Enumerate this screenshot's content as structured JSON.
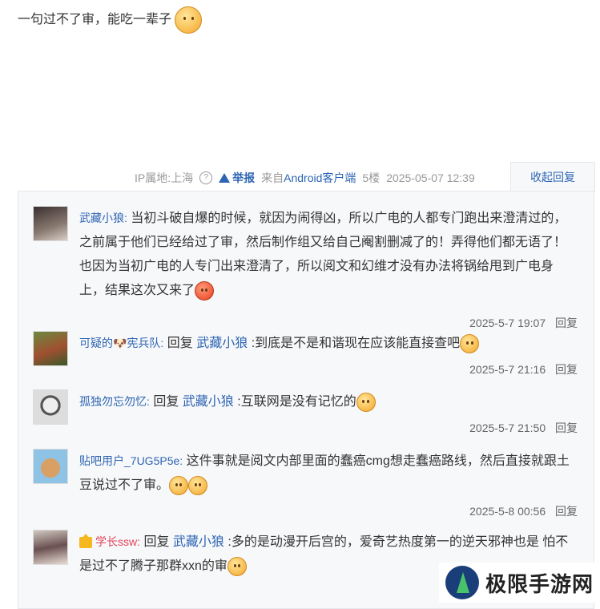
{
  "post": {
    "text": "一句过不了审，能吃一辈子"
  },
  "meta": {
    "ip": "IP属地:上海",
    "help": "?",
    "report": "举报",
    "client": "来自Android客户端",
    "floor": "5楼",
    "time": "2025-05-07 12:39",
    "collapse": "收起回复"
  },
  "replies": [
    {
      "user": "武藏小狼:",
      "text": " 当初斗破自爆的时候，就因为闹得凶，所以广电的人都专门跑出来澄清过的，之前属于他们已经给过了审，然后制作组又给自己阉割删减了的！弄得他们都无语了！也因为当初广电的人专门出来澄清了，所以阅文和幻维才没有办法将锅给甩到广电身上，结果这次又来了",
      "time": "2025-5-7 19:07",
      "reply": "回复"
    },
    {
      "user": "可疑的🐶宪兵队:",
      "pre": " 回复 ",
      "at": "武藏小狼",
      "text": " :到底是不是和谐现在应该能直接查吧",
      "time": "2025-5-7 21:16",
      "reply": "回复"
    },
    {
      "user": "孤独勿忘勿忆:",
      "pre": " 回复 ",
      "at": "武藏小狼",
      "text": " :互联网是没有记忆的",
      "time": "2025-5-7 21:50",
      "reply": "回复"
    },
    {
      "user": "贴吧用户_7UG5P5e:",
      "text": " 这件事就是阅文内部里面的蠢癌cmg想走蠢癌路线，然后直接就跟土豆说过不了审。",
      "time": "2025-5-8 00:56",
      "reply": "回复"
    },
    {
      "user": "学长ssw:",
      "pre": " 回复 ",
      "at": "武藏小狼",
      "text": " :多的是动漫开后宫的，爱奇艺热度第一的逆天邪神也是 怕不是过不了腾子那群xxn的审"
    }
  ],
  "watermark": {
    "text": "极限手游网"
  }
}
